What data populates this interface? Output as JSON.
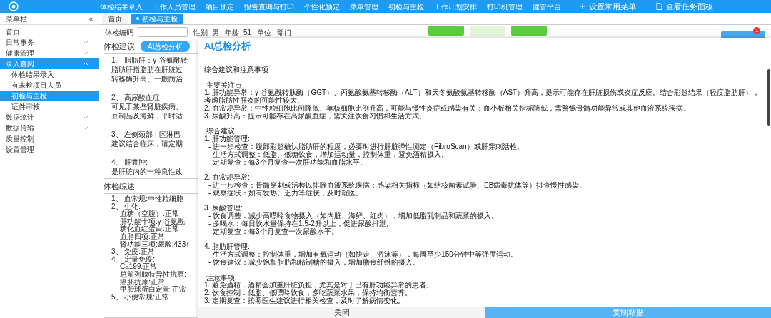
{
  "top_menu": {
    "items": [
      {
        "label": "体检结果录入"
      },
      {
        "label": "工作人员管理"
      },
      {
        "label": "项目预定"
      },
      {
        "label": "报告查询与打印"
      },
      {
        "label": "个性化预定"
      },
      {
        "label": "菜单管理"
      },
      {
        "label": "初检与主检"
      },
      {
        "label": "工作计划安排"
      },
      {
        "label": "打印机管理"
      },
      {
        "label": "健管平台"
      }
    ],
    "actions": [
      {
        "kind": "add",
        "label": "设置常用菜单"
      },
      {
        "kind": "panel",
        "label": "查看任务面板"
      }
    ]
  },
  "sidebar": {
    "title": "菜单栏",
    "collapse": "«",
    "items": [
      {
        "label": "首页",
        "selected": false
      },
      {
        "label": "日常事务",
        "selected": false,
        "expanded": false
      },
      {
        "label": "健康管理",
        "selected": false,
        "expanded": false
      },
      {
        "label": "录入查阅",
        "selected": true,
        "expanded": true,
        "children": [
          {
            "label": "体检结果录入",
            "selected": false
          },
          {
            "label": "有未检项目人员",
            "selected": false
          },
          {
            "label": "初检与主检",
            "selected": true
          },
          {
            "label": "证件审核",
            "selected": false
          }
        ]
      },
      {
        "label": "数据统计",
        "selected": false,
        "expanded": false
      },
      {
        "label": "数据传输",
        "selected": false,
        "expanded": false
      },
      {
        "label": "质量控制",
        "selected": false
      },
      {
        "label": "设置管理",
        "selected": false
      }
    ]
  },
  "tabs": [
    {
      "label": "首页",
      "selected": false
    },
    {
      "label": "初检与主检",
      "selected": true
    }
  ],
  "form": {
    "fields": [
      {
        "label": "体检编码",
        "kind": "input"
      },
      {
        "label": "性别",
        "value": "男"
      },
      {
        "label": "年龄",
        "value": "51"
      },
      {
        "label": "单位"
      },
      {
        "label": "部门"
      }
    ],
    "buttons": [
      {
        "kind": "green"
      },
      {
        "kind": "light"
      },
      {
        "kind": "green"
      }
    ],
    "badge": "1"
  },
  "advice": {
    "title": "体检建议",
    "ai_button": "AI总检分析",
    "paragraphs": [
      [
        "1、 脂肪肝；γ-谷氨酰转",
        "脂肪肝指脂肪在肝脏过",
        "转移酶升高。一般防治"
      ],
      [
        "2、 高尿酸血症:",
        "可见于某些肾脏疾病、",
        "豆制品及海鲜，平时适"
      ],
      [
        "3、 左侧颈部 I 区淋巴",
        "建议结合临床，请定期"
      ],
      [
        "4、 肝囊肿:",
        "是肝脏内的一种良性改"
      ]
    ]
  },
  "summary": {
    "title": "体检综述",
    "items": [
      {
        "text": "1、 血常规:中性粒细胞"
      },
      {
        "text": "2、 生化:",
        "children": [
          "血糖（空腹）:正常",
          "肝功能十项:γ-谷氨酰",
          "糖化血红蛋白:正常",
          "血脂四项:正常",
          "肾功能三项:尿酸:433↑"
        ]
      },
      {
        "text": "3、 免疫:正常"
      },
      {
        "text": "4、 定量免疫:",
        "children": [
          "Ca199:正常",
          "总前列腺特异性抗原:",
          "癌胚抗原:正常",
          "甲胎球蛋白定量:正常"
        ]
      },
      {
        "text": "5、 小便常规:正常"
      }
    ]
  },
  "modal": {
    "title": "AI总检分析",
    "intro": "综合建议和注意事项",
    "sections": [
      {
        "heading": "主要关注点:",
        "items": [
          {
            "text": "1. 肝功能异常：γ-谷氨酰转肽酶（GGT）、丙氨酸氨基转移酶（ALT）和天冬氨酸氨基转移酶（AST）升高，提示可能存在肝脏损伤或炎症反应。结合彩超结果（轻度脂肪肝），考虑脂肪性肝炎的可能性较大。"
          },
          {
            "text": "2. 血常规异常：中性粒细胞比例降低、单核细胞比例升高，可能与慢性炎症或感染有关；血小板相关指标降低，需警惕骨髓功能异常或其他血液系统疾病。"
          },
          {
            "text": "3. 尿酸升高：提示可能存在高尿酸血症，需关注饮食习惯和生活方式。"
          }
        ]
      },
      {
        "heading": "综合建议:",
        "items": [
          {
            "text": "1. 肝功能管理:",
            "children": [
              "- 进一步检查：腹部彩超确认脂肪肝的程度，必要时进行肝脏弹性测定（FibroScan）或肝穿刺活检。",
              "- 生活方式调整：低脂、低糖饮食，增加运动量，控制体重，避免酒精摄入。",
              "- 定期复查：每3个月复查一次肝功能和血脂水平。"
            ]
          },
          {
            "text": "2. 血常规异常:",
            "children": [
              "- 进一步检查：骨髓穿刺或活检以排除血液系统疾病；感染相关指标（如结核菌素试验、EB病毒抗体等）排查慢性感染。",
              "- 观察症状：如有发热、乏力等症状，及时就医。"
            ]
          },
          {
            "text": "3. 尿酸管理:",
            "children": [
              "- 饮食调整：减少高嘌呤食物摄入（如内脏、海鲜、红肉），增加低脂乳制品和蔬菜的摄入。",
              "- 多喝水：每日饮水量保持在1.5-2升以上，促进尿酸排泄。",
              "- 定期复查：每3个月复查一次尿酸水平。"
            ]
          },
          {
            "text": "4. 脂肪肝管理:",
            "children": [
              "- 生活方式调整：控制体重，增加有氧运动（如快走、游泳等），每周至少150分钟中等强度运动。",
              "- 饮食建议：减少饱和脂肪和精制糖的摄入，增加膳食纤维的摄入。"
            ]
          }
        ]
      },
      {
        "heading": "注意事项:",
        "items": [
          {
            "text": "1. 避免酒精：酒精会加重肝脏负担，尤其是对于已有肝功能异常的患者。"
          },
          {
            "text": "2. 饮食控制：低脂、低嘌呤饮食，多吃蔬菜水果，保持均衡营养。"
          },
          {
            "text": "3. 定期复查：按照医生建议进行相关检查，及时了解病情变化。"
          }
        ]
      }
    ],
    "buttons": [
      {
        "kind": "plain",
        "label": "关闭"
      },
      {
        "kind": "primary",
        "label": "复制粘贴"
      }
    ]
  }
}
